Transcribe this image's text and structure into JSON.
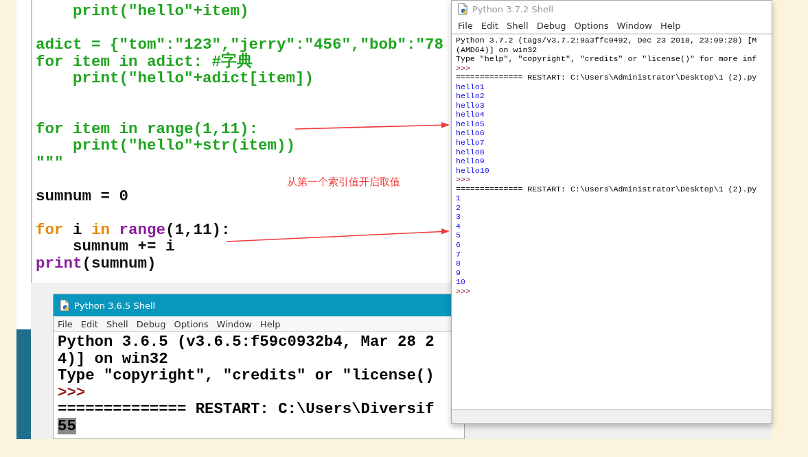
{
  "editor": {
    "lines": [
      {
        "kind": "code",
        "segments": [
          {
            "text": "    print(\"hello\"+item)",
            "kind": "string"
          }
        ]
      },
      {
        "kind": "blank"
      },
      {
        "kind": "code",
        "segments": [
          {
            "text": "adict = {\"tom\":\"123\",\"jerry\":\"456\",\"bob\":\"78",
            "kind": "string"
          }
        ]
      },
      {
        "kind": "code",
        "segments": [
          {
            "text": "for item in adict: #字典",
            "kind": "string"
          }
        ]
      },
      {
        "kind": "code",
        "segments": [
          {
            "text": "    print(\"hello\"+adict[item])",
            "kind": "string"
          }
        ]
      },
      {
        "kind": "blank"
      },
      {
        "kind": "blank"
      },
      {
        "kind": "code",
        "segments": [
          {
            "text": "for item in range(1,11):",
            "kind": "string"
          }
        ]
      },
      {
        "kind": "code",
        "segments": [
          {
            "text": "    print(\"hello\"+str(item))",
            "kind": "string"
          }
        ]
      },
      {
        "kind": "code",
        "segments": [
          {
            "text": "\"\"\"",
            "kind": "string"
          }
        ]
      },
      {
        "kind": "blank"
      },
      {
        "kind": "code",
        "segments": [
          {
            "text": "sumnum = 0",
            "kind": "plain"
          }
        ]
      },
      {
        "kind": "blank"
      },
      {
        "kind": "code",
        "segments": [
          {
            "text": "for",
            "kind": "keyword"
          },
          {
            "text": " i ",
            "kind": "plain"
          },
          {
            "text": "in ",
            "kind": "keyword"
          },
          {
            "text": "range",
            "kind": "builtin"
          },
          {
            "text": "(1,11):",
            "kind": "plain"
          }
        ]
      },
      {
        "kind": "code",
        "segments": [
          {
            "text": "    sumnum += i",
            "kind": "plain"
          }
        ]
      },
      {
        "kind": "code",
        "segments": [
          {
            "text": "print",
            "kind": "builtin"
          },
          {
            "text": "(sumnum)",
            "kind": "plain"
          }
        ]
      }
    ]
  },
  "annotation": {
    "text": "从第一个索引值开启取值"
  },
  "shell_372": {
    "title": "Python 3.7.2 Shell",
    "menu": [
      "File",
      "Edit",
      "Shell",
      "Debug",
      "Options",
      "Window",
      "Help"
    ],
    "lines": [
      {
        "text": "Python 3.7.2 (tags/v3.7.2:9a3ffc0492, Dec 23 2018, 23:09:28) [M",
        "kind": "banner"
      },
      {
        "text": "(AMD64)] on win32",
        "kind": "banner"
      },
      {
        "text": "Type \"help\", \"copyright\", \"credits\" or \"license()\" for more inf",
        "kind": "banner"
      },
      {
        "text": ">>>",
        "kind": "prompt"
      },
      {
        "text": "============== RESTART: C:\\Users\\Administrator\\Desktop\\1 (2).py",
        "kind": "banner"
      },
      {
        "text": "hello1",
        "kind": "stdout"
      },
      {
        "text": "hello2",
        "kind": "stdout"
      },
      {
        "text": "hello3",
        "kind": "stdout"
      },
      {
        "text": "hello4",
        "kind": "stdout"
      },
      {
        "text": "hello5",
        "kind": "stdout"
      },
      {
        "text": "hello6",
        "kind": "stdout"
      },
      {
        "text": "hello7",
        "kind": "stdout"
      },
      {
        "text": "hello8",
        "kind": "stdout"
      },
      {
        "text": "hello9",
        "kind": "stdout"
      },
      {
        "text": "hello10",
        "kind": "stdout"
      },
      {
        "text": ">>>",
        "kind": "prompt"
      },
      {
        "text": "============== RESTART: C:\\Users\\Administrator\\Desktop\\1 (2).py",
        "kind": "banner"
      },
      {
        "text": "1",
        "kind": "stdout"
      },
      {
        "text": "2",
        "kind": "stdout"
      },
      {
        "text": "3",
        "kind": "stdout"
      },
      {
        "text": "4",
        "kind": "stdout"
      },
      {
        "text": "5",
        "kind": "stdout"
      },
      {
        "text": "6",
        "kind": "stdout"
      },
      {
        "text": "7",
        "kind": "stdout"
      },
      {
        "text": "8",
        "kind": "stdout"
      },
      {
        "text": "9",
        "kind": "stdout"
      },
      {
        "text": "10",
        "kind": "stdout"
      },
      {
        "text": ">>>",
        "kind": "prompt"
      }
    ]
  },
  "shell_365": {
    "title": "Python 3.6.5 Shell",
    "menu": [
      "File",
      "Edit",
      "Shell",
      "Debug",
      "Options",
      "Window",
      "Help"
    ],
    "lines": [
      {
        "text": "Python 3.6.5 (v3.6.5:f59c0932b4, Mar 28 2",
        "kind": "banner",
        "selected": false
      },
      {
        "text": "4)] on win32",
        "kind": "banner",
        "selected": false
      },
      {
        "text": "Type \"copyright\", \"credits\" or \"license()",
        "kind": "banner",
        "selected": false
      },
      {
        "text": ">>>",
        "kind": "prompt",
        "selected": false
      },
      {
        "text": "============== RESTART: C:\\Users\\Diversif",
        "kind": "banner",
        "selected": false
      },
      {
        "text": "55",
        "kind": "banner",
        "selected": true
      }
    ]
  }
}
